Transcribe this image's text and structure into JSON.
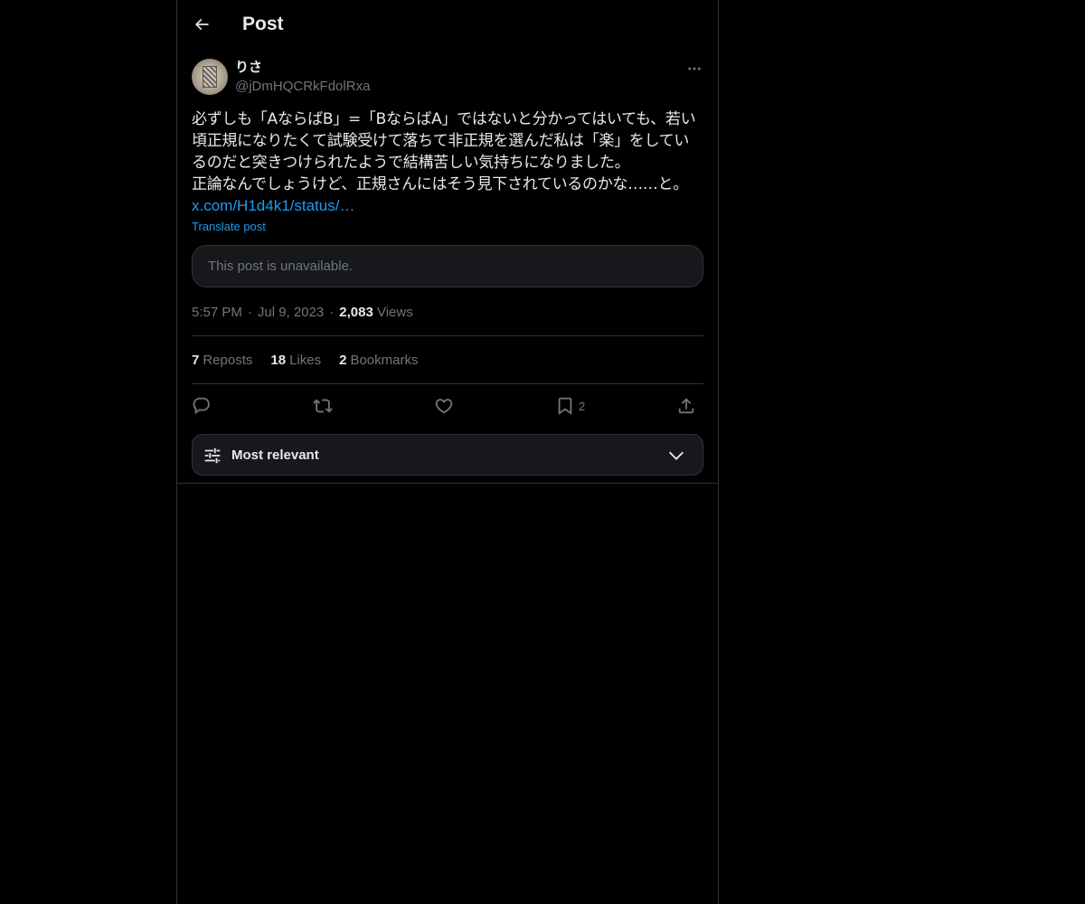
{
  "header": {
    "title": "Post",
    "back_icon": "arrow-left-icon"
  },
  "post": {
    "author": {
      "display_name": "りさ",
      "handle": "@jDmHQCRkFdolRxa"
    },
    "text": "必ずしも「AならばB」=「BならばA」ではないと分かってはいても、若い\n頃正規になりたくて試験受けて落ちて非正規を選んだ私は「楽」をしてい\nるのだと突きつけられたようで結構苦しい気持ちになりました。\n正論なんでしょうけど、正規さんにはそう見下されているのかな……と。",
    "link": "x.com/H1d4k1/status/…",
    "translate_label": "Translate post",
    "quote_unavailable": "This post is unavailable.",
    "time": "5:57 PM",
    "date": "Jul 9, 2023",
    "views_count": "2,083",
    "views_label": "Views",
    "stats": {
      "reposts_count": "7",
      "reposts_label": "Reposts",
      "likes_count": "18",
      "likes_label": "Likes",
      "bookmarks_count": "2",
      "bookmarks_label": "Bookmarks"
    },
    "actions": {
      "reply_icon": "reply-icon",
      "repost_icon": "repost-icon",
      "like_icon": "heart-icon",
      "bookmark_icon": "bookmark-icon",
      "bookmark_count": "2",
      "share_icon": "share-icon"
    }
  },
  "sort": {
    "label": "Most relevant",
    "icon": "sliders-icon",
    "chevron": "chevron-down-icon"
  },
  "colors": {
    "background": "#000000",
    "text": "#e7e9ea",
    "muted": "#71767b",
    "accent": "#1d9bf0",
    "border": "#2f3336"
  }
}
